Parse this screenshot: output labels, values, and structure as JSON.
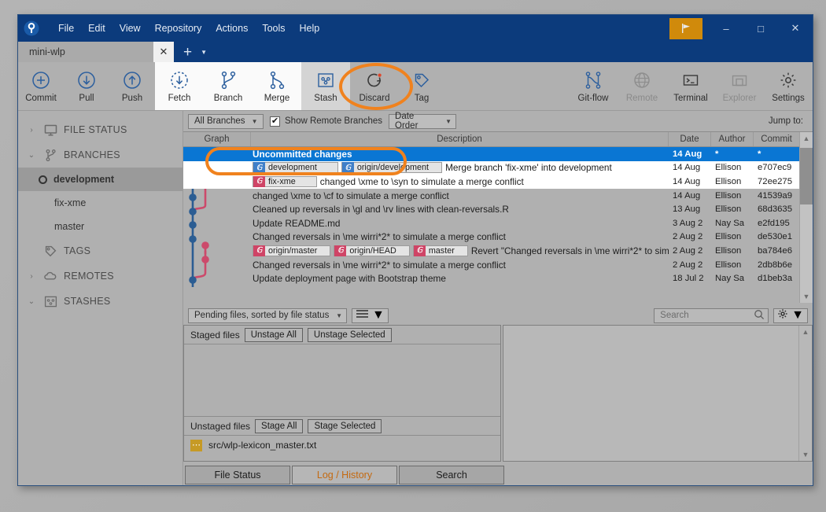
{
  "window": {
    "app_icon": "sourcetree-logo-icon",
    "menus": [
      "File",
      "Edit",
      "View",
      "Repository",
      "Actions",
      "Tools",
      "Help"
    ],
    "flag_button": "flag-icon",
    "minimize": "–",
    "maximize": "□",
    "close": "✕",
    "accent_blue": "#0c3b7c",
    "highlight_orange": "#f0821e",
    "selection_blue": "#0a76d3"
  },
  "tabs": {
    "repo_tab": "mini-wlp",
    "close_glyph": "✕",
    "new_tab_plus": "+",
    "new_tab_caret": "▼"
  },
  "toolbar": {
    "items": [
      {
        "label": "Commit",
        "icon": "plus-circle-icon",
        "group": "left",
        "state": "normal"
      },
      {
        "label": "Pull",
        "icon": "arrow-down-circle-icon",
        "group": "left",
        "state": "normal"
      },
      {
        "label": "Push",
        "icon": "arrow-up-circle-icon",
        "group": "left",
        "state": "normal"
      },
      {
        "label": "Fetch",
        "icon": "fetch-dashed-circle-icon",
        "group": "mid",
        "state": "normal"
      },
      {
        "label": "Branch",
        "icon": "branch-icon",
        "group": "mid",
        "state": "normal"
      },
      {
        "label": "Merge",
        "icon": "merge-icon",
        "group": "mid",
        "state": "normal"
      },
      {
        "label": "Stash",
        "icon": "stash-icon",
        "group": "mid",
        "state": "active"
      },
      {
        "label": "Discard",
        "icon": "discard-revert-icon",
        "group": "right",
        "state": "normal"
      },
      {
        "label": "Tag",
        "icon": "tag-icon",
        "group": "right",
        "state": "normal"
      },
      {
        "label": "Git-flow",
        "icon": "gitflow-icon",
        "group": "far",
        "state": "normal"
      },
      {
        "label": "Remote",
        "icon": "globe-icon",
        "group": "far",
        "state": "disabled"
      },
      {
        "label": "Terminal",
        "icon": "terminal-icon",
        "group": "far",
        "state": "normal"
      },
      {
        "label": "Explorer",
        "icon": "folder-icon",
        "group": "far",
        "state": "disabled"
      },
      {
        "label": "Settings",
        "icon": "gear-icon",
        "group": "far",
        "state": "normal"
      }
    ]
  },
  "sidebar": {
    "sections": [
      {
        "label": "FILE STATUS",
        "icon": "monitor-icon",
        "expanded": false,
        "chevron": "›"
      },
      {
        "label": "BRANCHES",
        "icon": "branch-icon",
        "expanded": true,
        "chevron": "⌄"
      },
      {
        "label": "TAGS",
        "icon": "tag-icon",
        "expanded": false,
        "chevron": ""
      },
      {
        "label": "REMOTES",
        "icon": "cloud-icon",
        "expanded": false,
        "chevron": "›"
      },
      {
        "label": "STASHES",
        "icon": "stash-icon",
        "expanded": true,
        "chevron": "⌄"
      }
    ],
    "branches": [
      {
        "label": "development",
        "selected": true
      },
      {
        "label": "fix-xme",
        "selected": false
      },
      {
        "label": "master",
        "selected": false
      }
    ]
  },
  "log_toolbar": {
    "branch_filter": "All Branches",
    "show_remote_label": "Show Remote Branches",
    "show_remote_checked": true,
    "check_glyph": "✔",
    "order_filter": "Date Order",
    "jump_to": "Jump to:"
  },
  "log": {
    "columns": [
      "Graph",
      "Description",
      "Date",
      "Author",
      "Commit"
    ],
    "rows": [
      {
        "description": "Uncommitted changes",
        "date": "14 Aug",
        "author": "*",
        "commit": "*",
        "selected": true,
        "badges": []
      },
      {
        "description": "Merge branch 'fix-xme' into development",
        "date": "14 Aug",
        "author": "Ellison",
        "commit": "e707ec9",
        "selected": false,
        "badges": [
          {
            "text": "development",
            "kind": "blue",
            "icon": "branch-badge-icon"
          },
          {
            "text": "origin/development",
            "kind": "blue",
            "icon": "branch-badge-icon"
          }
        ]
      },
      {
        "description": "changed \\xme to \\syn to simulate a merge conflict",
        "date": "14 Aug",
        "author": "Ellison",
        "commit": "72ee275",
        "selected": false,
        "badges": [
          {
            "text": "fix-xme",
            "kind": "pink",
            "icon": "branch-badge-icon"
          }
        ]
      },
      {
        "description": "changed \\xme to \\cf to simulate a merge conflict",
        "date": "14 Aug",
        "author": "Ellison",
        "commit": "41539a9",
        "selected": false,
        "badges": []
      },
      {
        "description": "Cleaned up reversals in \\gl and \\rv lines with clean-reversals.R",
        "date": "13 Aug",
        "author": "Ellison",
        "commit": "68d3635",
        "selected": false,
        "badges": []
      },
      {
        "description": "Update README.md",
        "date": "3 Aug 2",
        "author": "Nay Sa",
        "commit": "e2fd195",
        "selected": false,
        "badges": []
      },
      {
        "description": "Changed reversals in \\me wirri*2* to simulate a merge conflict",
        "date": "2 Aug 2",
        "author": "Ellison",
        "commit": "de530e1",
        "selected": false,
        "badges": []
      },
      {
        "description": "Revert \"Changed reversals in \\me wirri*2* to sim",
        "date": "2 Aug 2",
        "author": "Ellison",
        "commit": "ba784e6",
        "selected": false,
        "badges": [
          {
            "text": "origin/master",
            "kind": "pink",
            "icon": "branch-badge-icon"
          },
          {
            "text": "origin/HEAD",
            "kind": "pink",
            "icon": "branch-badge-icon"
          },
          {
            "text": "master",
            "kind": "pink",
            "icon": "branch-badge-icon"
          }
        ]
      },
      {
        "description": "Changed reversals in \\me wirri*2* to simulate a merge conflict",
        "date": "2 Aug 2",
        "author": "Ellison",
        "commit": "2db8b6e",
        "selected": false,
        "badges": []
      },
      {
        "description": "Update deployment page with Bootstrap theme",
        "date": "18 Jul 2",
        "author": "Nay Sa",
        "commit": "d1beb3a",
        "selected": false,
        "badges": []
      }
    ]
  },
  "file_panel": {
    "sort_filter": "Pending files, sorted by file status",
    "view_mode_icon": "list-view-icon",
    "search_placeholder": "Search",
    "search_icon": "search-icon",
    "settings_icon": "gear-icon",
    "staged": {
      "title": "Staged files",
      "unstage_all": "Unstage All",
      "unstage_selected": "Unstage Selected",
      "files": []
    },
    "unstaged": {
      "title": "Unstaged files",
      "stage_all": "Stage All",
      "stage_selected": "Stage Selected",
      "files": [
        {
          "name": "src/wlp-lexicon_master.txt",
          "status_icon": "modified-file-icon"
        }
      ]
    }
  },
  "bottom_tabs": [
    {
      "label": "File Status",
      "active": false
    },
    {
      "label": "Log / History",
      "active": true
    },
    {
      "label": "Search",
      "active": false
    }
  ]
}
